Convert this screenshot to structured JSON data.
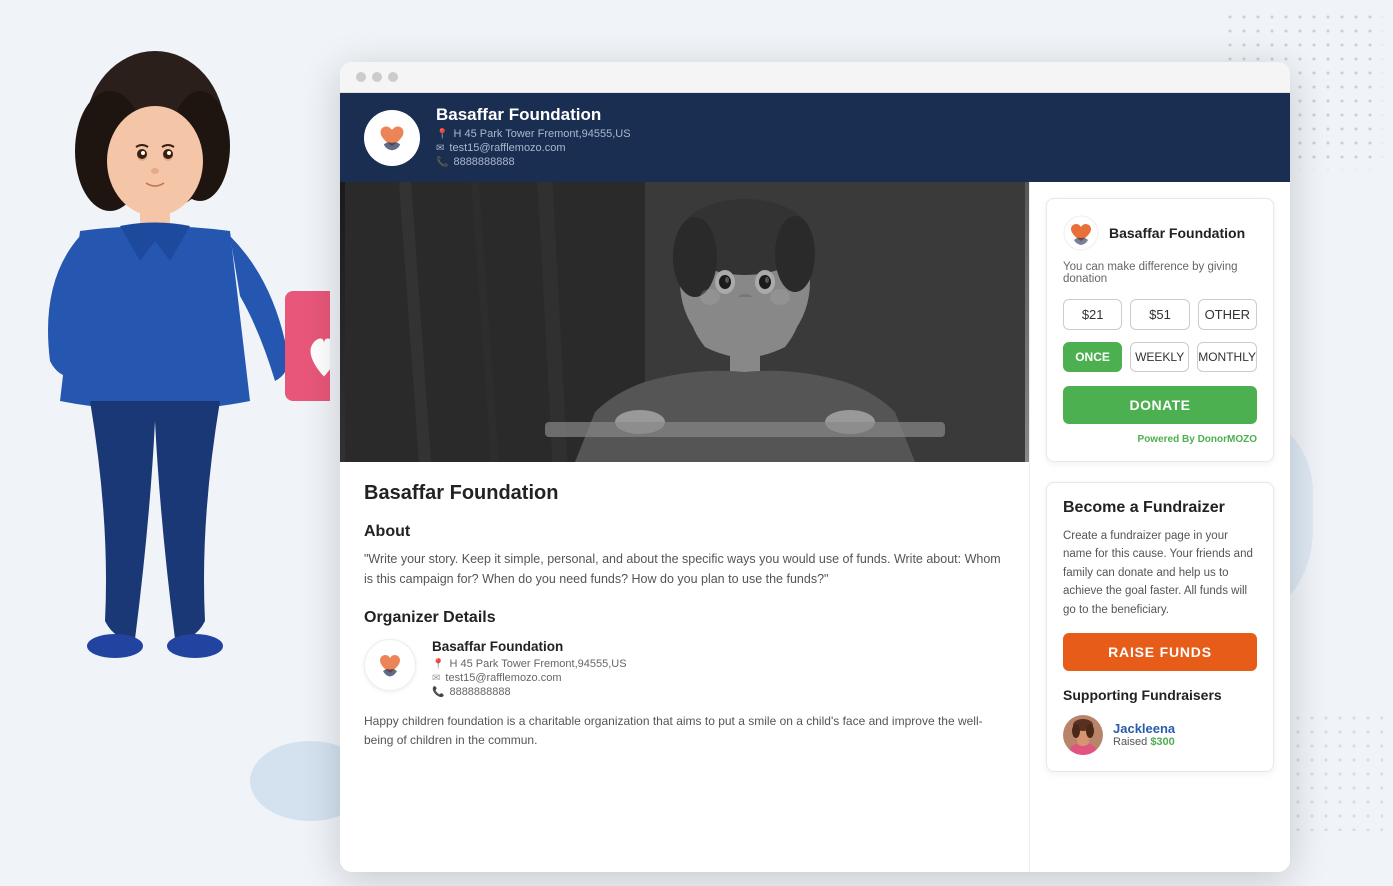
{
  "decorative": {
    "dot_pattern": true,
    "blob": true
  },
  "browser": {
    "dots": [
      "#f0f0f0",
      "#f0f0f0",
      "#f0f0f0"
    ]
  },
  "header": {
    "org_name": "Basaffar Foundation",
    "address": "H 45 Park Tower Fremont,94555,US",
    "email": "test15@rafflemozo.com",
    "phone": "8888888888",
    "address_icon": "📍",
    "email_icon": "✉",
    "phone_icon": "📞"
  },
  "content": {
    "page_title": "Basaffar Foundation",
    "about_title": "About",
    "about_text": "\"Write your story. Keep it simple, personal, and about the specific ways you would use of funds. Write about: Whom is this campaign for? When do you need funds? How do you plan to use the funds?\"",
    "organizer_title": "Organizer Details",
    "organizer_name": "Basaffar Foundation",
    "organizer_address": "H 45 Park Tower Fremont,94555,US",
    "organizer_email": "test15@rafflemozo.com",
    "organizer_phone": "8888888888",
    "organizer_desc": "Happy children foundation is a charitable organization that aims to put a smile on a child's face and improve the well-being of children in the commun."
  },
  "donation_widget": {
    "org_name": "Basaffar Foundation",
    "subtitle": "You can make difference by giving donation",
    "amounts": [
      "$21",
      "$51",
      "OTHER"
    ],
    "frequencies": [
      "ONCE",
      "WEEKLY",
      "MONTHLY"
    ],
    "active_freq": 0,
    "donate_label": "DONATE",
    "powered_label": "Powered By",
    "powered_brand": "DonorMOZO"
  },
  "fundraiser_widget": {
    "title": "Become a Fundraizer",
    "description": "Create a fundraizer page in your name for this cause. Your friends and family can donate and help us to achieve the goal faster. All funds will go to the beneficiary.",
    "button_label": "RAISE FUNDS",
    "supporting_title": "Supporting Fundraisers",
    "supporters": [
      {
        "name": "Jackleena",
        "raised_label": "Raised",
        "raised_amount": "$300"
      }
    ]
  }
}
